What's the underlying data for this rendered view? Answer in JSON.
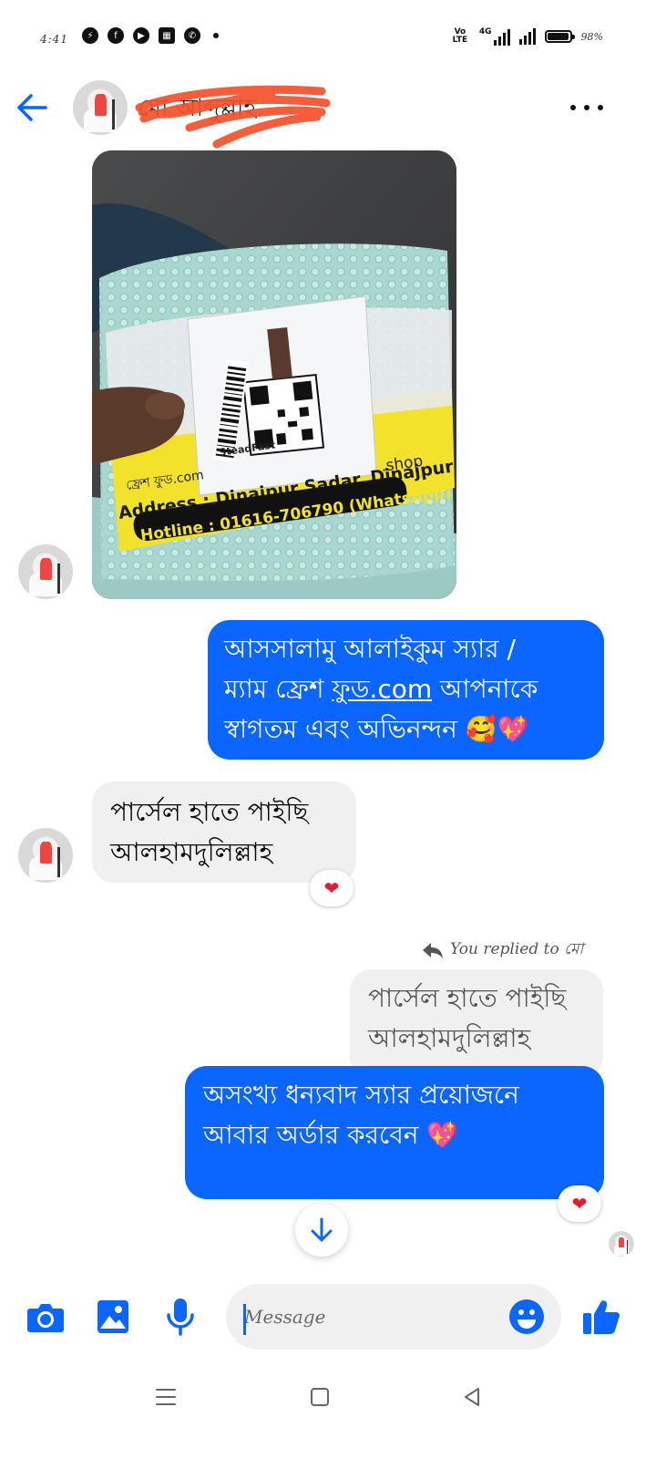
{
  "status_bar": {
    "time": "4:41",
    "network": "4G",
    "volte": "Vo LTE",
    "battery_percent": "98%",
    "battery_level": 0.98,
    "left_icons": [
      "messenger-icon",
      "facebook-icon",
      "youtube-icon",
      "news-icon",
      "whatsapp-icon"
    ]
  },
  "header": {
    "contact_name": "মো আব্দুল্লাহ",
    "name_redacted": true
  },
  "messages": [
    {
      "type": "photo",
      "direction": "in",
      "label_text": {
        "brand": "SteadFast",
        "shop": ".shop",
        "page": "ফ্রেশ ফুড.com",
        "address": "Address : Dinajpur Sadar, Dinajpur",
        "hotline": "Hotline : 01616-706790 (WhatsApp)"
      }
    },
    {
      "type": "text",
      "direction": "out",
      "text_line1": "আসসালামু আলাইকুম  স্যার /",
      "text_line2": "ম্যাম  ফ্রেশ ",
      "text_link": "ফুড.com",
      "text_line2_end": " আপনাকে",
      "text_line3": "স্বাগতম এবং অভিনন্দন 🥰💖"
    },
    {
      "type": "text",
      "direction": "in",
      "text": "পার্সেল হাতে পাইছি আলহামদুলিল্লাহ",
      "reaction": "❤"
    },
    {
      "type": "reply",
      "direction": "out",
      "reply_label": "You replied to মো",
      "quoted_text": "পার্সেল হাতে পাইছি আলহামদুলিল্লাহ",
      "text": "অসংখ্য ধন্যবাদ স্যার প্রয়োজনে আবার অর্ডার করবেন 💖",
      "reaction": "❤"
    }
  ],
  "composer": {
    "placeholder": "Message",
    "camera_icon": "camera-icon",
    "gallery_icon": "image-icon",
    "mic_icon": "microphone-icon",
    "emoji_icon": "smiley-icon",
    "like_icon": "thumbs-up-icon"
  },
  "nav_bar": {
    "menu_icon": "menu-icon",
    "home_icon": "home-icon",
    "back_icon": "back-triangle-icon"
  },
  "colors": {
    "accent": "#0a66ff",
    "incoming_bubble": "#f0f0f0",
    "heart": "#e11d31"
  }
}
